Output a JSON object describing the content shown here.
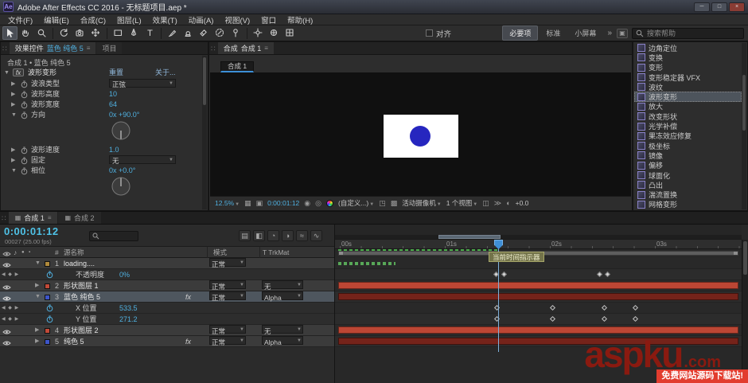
{
  "window": {
    "app_badge": "Ae",
    "title": "Adobe After Effects CC 2016 - 无标题项目.aep *",
    "controls": {
      "minimize": "─",
      "maximize": "□",
      "close": "×"
    }
  },
  "menubar": {
    "items": [
      "文件(F)",
      "编辑(E)",
      "合成(C)",
      "图层(L)",
      "效果(T)",
      "动画(A)",
      "视图(V)",
      "窗口",
      "帮助(H)"
    ]
  },
  "toolbar": {
    "tools": [
      "selection-tool",
      "hand-tool",
      "zoom-tool",
      "rotation-tool",
      "camera-tool",
      "pan-behind-tool",
      "rectangle-tool",
      "pen-tool",
      "type-tool",
      "brush-tool",
      "clone-stamp-tool",
      "eraser-tool",
      "roto-brush-tool",
      "puppet-pin-tool"
    ],
    "snapping_label": "对齐",
    "workspace_tabs": [
      "必要项",
      "标准",
      "小屏幕"
    ],
    "active_index": 0,
    "overflow": "»",
    "search_placeholder": "搜索帮助"
  },
  "effect_controls": {
    "panel_tab": "效果控件",
    "panel_tab_target": "蓝色 纯色 5",
    "project_tab": "项目",
    "breadcrumb": "合成 1 • 蓝色 纯色 5",
    "effect_name": "波形变形",
    "reset_label": "重置",
    "about_label": "关于...",
    "properties": [
      {
        "label": "波浪类型",
        "value": "正弦",
        "control": "dropdown"
      },
      {
        "label": "波形高度",
        "value": "10",
        "control": "scalar"
      },
      {
        "label": "波形宽度",
        "value": "64",
        "control": "scalar"
      },
      {
        "label": "方向",
        "value": "0x +90.0°",
        "control": "dial"
      },
      {
        "label": "波形速度",
        "value": "1.0",
        "control": "scalar"
      },
      {
        "label": "固定",
        "value": "无",
        "control": "dropdown"
      },
      {
        "label": "相位",
        "value": "0x +0.0°",
        "control": "dial"
      }
    ]
  },
  "viewer": {
    "panel_tab": "合成",
    "comp_name": "合成 1",
    "statusbar": {
      "zoom": "12.5%",
      "timecode": "0:00:01:12",
      "resolution": "(自定义...)",
      "camera": "活动摄像机",
      "views": "1 个视图",
      "exposure": "+0.0"
    }
  },
  "effects_presets": {
    "items": [
      "边角定位",
      "变换",
      "变形",
      "变形稳定器 VFX",
      "波纹",
      "波形变形",
      "放大",
      "改变形状",
      "光学补偿",
      "果冻效应修复",
      "极坐标",
      "镜像",
      "偏移",
      "球面化",
      "凸出",
      "湍流置换",
      "网格变形"
    ],
    "selected_index": 5
  },
  "timeline": {
    "tabs": [
      {
        "label": "合成 1"
      },
      {
        "label": "合成 2"
      }
    ],
    "timecode": "0:00:01:12",
    "frame_info": "00027 (25.00 fps)",
    "columns": {
      "number": "#",
      "source_name": "源名称",
      "mode": "模式",
      "trkmat": "T TrkMat"
    },
    "rows": [
      {
        "type": "layer",
        "num": "1",
        "name": "loading....",
        "mode": "正常",
        "trkmat": "",
        "fx": "",
        "label_color": "#b08a3c"
      },
      {
        "type": "prop",
        "name": "不透明度",
        "value": "0%"
      },
      {
        "type": "layer",
        "num": "2",
        "name": "形状图层 1",
        "mode": "正常",
        "trkmat": "无",
        "fx": "",
        "label_color": "#c24a38"
      },
      {
        "type": "layer",
        "num": "3",
        "name": "蓝色 纯色 5",
        "mode": "正常",
        "trkmat": "Alpha",
        "fx": "fx",
        "label_color": "#3d55c8"
      },
      {
        "type": "prop",
        "name": "X 位置",
        "value": "533.5"
      },
      {
        "type": "prop",
        "name": "Y 位置",
        "value": "271.2"
      },
      {
        "type": "layer",
        "num": "4",
        "name": "形状图层 2",
        "mode": "正常",
        "trkmat": "无",
        "fx": "",
        "label_color": "#c24a38"
      },
      {
        "type": "layer",
        "num": "5",
        "name": "纯色 5",
        "mode": "正常",
        "trkmat": "Alpha",
        "fx": "fx",
        "label_color": "#3d55c8"
      }
    ],
    "ruler_labels": [
      "00s",
      "01s",
      "02s",
      "03s"
    ],
    "cti_tooltip": "当前时间指示器"
  },
  "watermark": {
    "brand": "aspku",
    "tld": ".com",
    "tagline": "免费网站源码下载站!"
  }
}
